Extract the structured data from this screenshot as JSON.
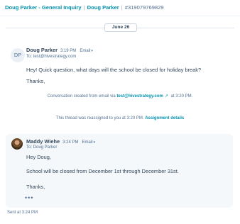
{
  "header": {
    "contact": "Doug Parker - General Inquiry",
    "separator": "|",
    "contact_short": "Doug Parker",
    "ticket_id": "#319079769829"
  },
  "date_divider": "June 26",
  "message1": {
    "avatar_initials": "DP",
    "sender": "Doug Parker",
    "time": "3:19 PM",
    "channel": "Email",
    "to": "To: test@hivestrategy.com",
    "body": "Hey! Quick question, what days will the school be closed for holiday break?",
    "signoff": "Thanks,"
  },
  "note_created": {
    "prefix": "Conversation created from email via",
    "email": "test@hivestrategy.com",
    "suffix": "at 3:20 PM."
  },
  "note_reassigned": {
    "text": "This thread was reassigned to you at 3:20 PM.",
    "link": "Assignment details"
  },
  "message2": {
    "sender": "Maddy Wiehe",
    "time": "3:24 PM",
    "channel": "Email",
    "to": "To: Doug Parker",
    "greeting": "Hey Doug,",
    "body": "School will be closed from December 1st through December 31st.",
    "signoff": "Thanks,",
    "more": "•••"
  },
  "sent_status": "Sent at 3:24 PM"
}
